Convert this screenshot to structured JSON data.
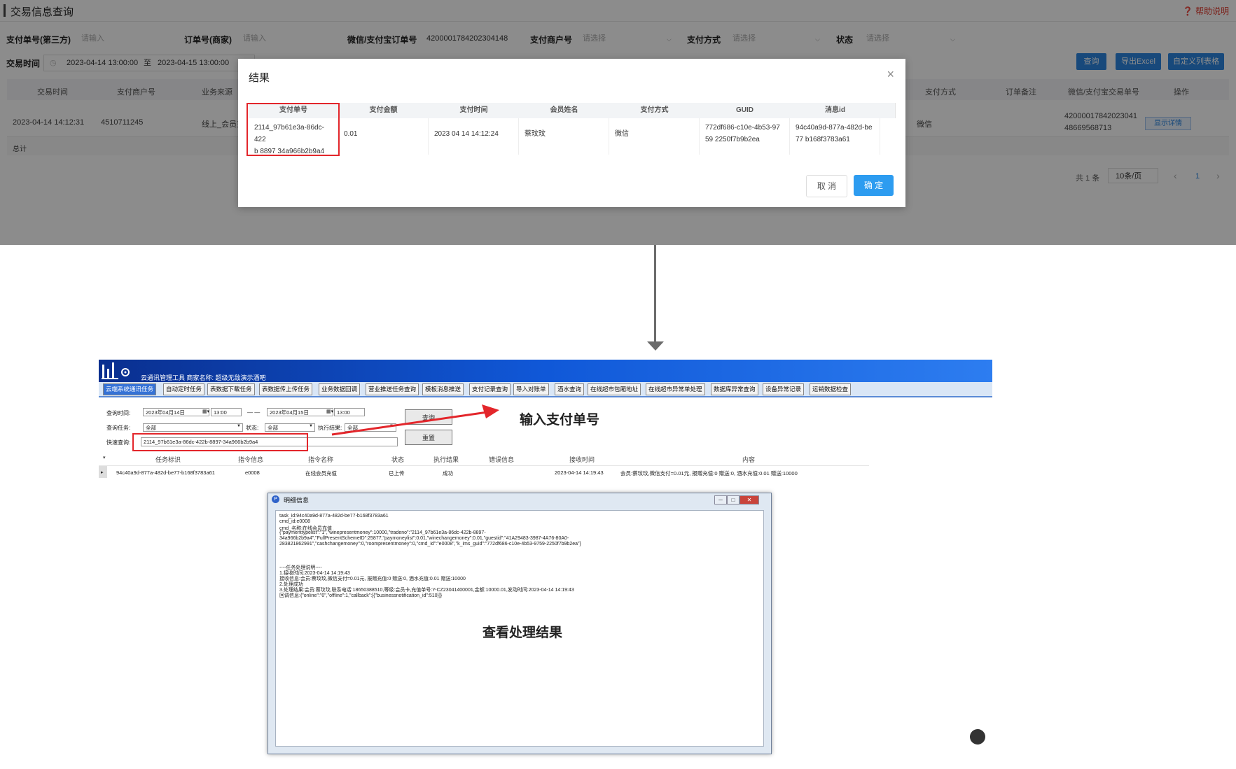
{
  "web": {
    "title": "交易信息查询",
    "help": "帮助说明",
    "filters": {
      "f1_label": "支付单号(第三方)",
      "f1_placeholder": "请输入",
      "f2_label": "订单号(商家)",
      "f2_placeholder": "请输入",
      "f3_label": "微信/支付宝订单号",
      "f3_value": "4200001784202304148",
      "f4_label": "支付商户号",
      "f4_placeholder": "请选择",
      "f5_label": "支付方式",
      "f5_placeholder": "请选择",
      "f6_label": "状态",
      "f6_placeholder": "请选择",
      "time_label": "交易时间",
      "time_start": "2023-04-14 13:00:00",
      "time_sep": "至",
      "time_end": "2023-04-15 13:00:00"
    },
    "buttons": {
      "query": "查询",
      "export": "导出Excel",
      "custom_cols": "自定义列表格"
    },
    "table_headers": [
      "交易时间",
      "支付商户号",
      "业务来源",
      "支付方式",
      "订单备注",
      "微信/支付宝交易单号",
      "操作"
    ],
    "row": {
      "time": "2023-04-14 14:12:31",
      "merchant": "4510711245",
      "source": "线上_会员充值",
      "paytype": "微信",
      "trade_no_l1": "42000017842023041",
      "trade_no_l2": "48669568713",
      "action": "显示详情"
    },
    "total": "总计",
    "pagination": {
      "count": "共 1 条",
      "per_page": "10条/页",
      "prev": "‹",
      "page": "1",
      "next": "›"
    }
  },
  "modal": {
    "title": "结果",
    "close": "×",
    "headers": [
      "支付单号",
      "支付金额",
      "支付时间",
      "会员姓名",
      "支付方式",
      "GUID",
      "消息id"
    ],
    "row": {
      "pay_no_l1": "2114_97b61e3a-86dc-422",
      "pay_no_l2": "b 8897 34a966b2b9a4",
      "amount": "0.01",
      "time": "2023 04 14 14:12:24",
      "member": "蔡玟玟",
      "paytype": "微信",
      "guid_l1": "772df686-c10e-4b53-97",
      "guid_l2": "59 2250f7b9b2ea",
      "msg_l1": "94c40a9d-877a-482d-be",
      "msg_l2": "77 b168f3783a61"
    },
    "cancel": "取 消",
    "ok": "确 定"
  },
  "app": {
    "banner_title": "云通讯管理工具 商家名称: 超级无敌演示酒吧",
    "tabs": [
      "云端系统通讯任务",
      "自动定时任务",
      "表数据下载任务",
      "表数据传上传任务",
      "业务数据回调",
      "营业推送任务查询",
      "模板消息推送",
      "支付记录查询",
      "导入对账单",
      "酒水查询",
      "在线超市包厢地址",
      "在线超市异常单处理",
      "数据库异常查询",
      "设备异常记录",
      "运销数据检查"
    ],
    "query_time_label": "查询时间:",
    "date_start": "2023年04月14日",
    "time_start": "13:00",
    "range_sep": "— —",
    "date_end": "2023年04月15日",
    "time_end": "13:00",
    "task_label": "查询任务:",
    "task_value": "全部",
    "state_label": "状态:",
    "state_value": "全部",
    "result_label": "执行结果:",
    "result_value": "全部",
    "quick_label": "快速查询:",
    "quick_value": "2114_97b61e3a-86dc-422b-8897-34a966b2b9a4",
    "query_btn": "查询",
    "reset_btn": "重置",
    "headers": [
      "任务标识",
      "指令信息",
      "指令名称",
      "状态",
      "执行结果",
      "错误信息",
      "接收时间",
      "内容"
    ],
    "row": {
      "task_id": "94c40a9d-877a-482d-be77-b168f3783a61",
      "cmd": "e0008",
      "cmd_name": "在线会员充值",
      "state": "已上传",
      "result": "成功",
      "time": "2023-04-14 14:19:43",
      "content": "会员:蔡玟玟,微信支付=0.01元, 报赠充值:0 赠送:0, 酒水充值:0.01 赠送:10000"
    }
  },
  "dialog": {
    "title": "明细信息",
    "lines": [
      "task_id:94c40a9d-877a-482d-be77-b168f3783a61",
      "cmd_id:e0008",
      "cmd_名称:在线会员充值",
      "{\"paymenttypelist\":\"1\",\"winepresentmoney\":10000,\"tradeno\":\"2114_97b61e3a-86dc-422b-8897-",
      "34a966b2b9a4\",\"FullPresentSchemeID\":25877,\"paymoneylist\":0.01,\"winechangemoney\":0.01,\"guestid\":\"41A29483-3987-4A76-80A0-",
      "283821862991\",\"cashchangemoney\":0,\"roompresentmoney\":0,\"cmd_id\":\"e0008\",\"k_ims_guid\":\"772df686-c10e-4b53-9759-2250f7b9b2ea\"}",
      "",
      "",
      "----任务处理说明----",
      "1.接收时间:2023-04-14 14:19:43",
      "接收信息:会员:蔡玟玟,微信支付=0.01元, 报赠充值:0 赠送:0, 酒水充值:0.01 赠送:10000",
      "2.处理成功",
      "3.处理结果:会员:蔡玟玟,联系电话:18650388510,等级:会员卡,充值单号:Y-CZ23041400001,金额:10000.01,发动时间:2023-04-14 14:19:43",
      "回调信息:{\"online\":\"0\",\"offline\":1,\"callback\":[{\"businessnotification_id\":510}]}"
    ]
  },
  "annotations": {
    "input_pay_no": "输入支付单号",
    "view_result": "查看处理结果"
  }
}
